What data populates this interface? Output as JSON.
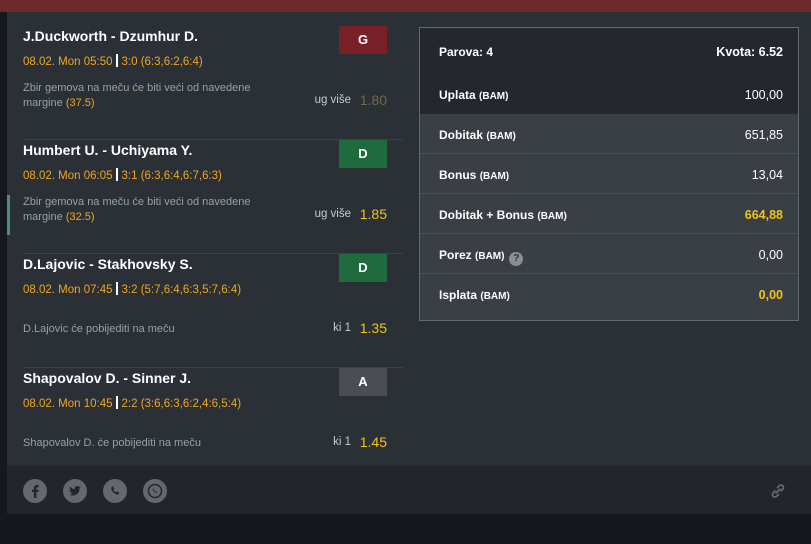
{
  "matches": [
    {
      "title": "J.Duckworth - Dzumhur D.",
      "datetime": "08.02. Mon 05:50",
      "result": "3:0 (6:3,6:2,6:4)",
      "desc": "Zbir gemova na meču će biti veći od navedene margine",
      "margin": "(37.5)",
      "type": "ug više",
      "odd": "1.80",
      "badge": "G"
    },
    {
      "title": "Humbert U. - Uchiyama Y.",
      "datetime": "08.02. Mon 06:05",
      "result": "3:1 (6:3,6:4,6:7,6:3)",
      "desc": "Zbir gemova na meču će biti veći od navedene margine",
      "margin": "(32.5)",
      "type": "ug više",
      "odd": "1.85",
      "badge": "D"
    },
    {
      "title": "D.Lajovic - Stakhovsky S.",
      "datetime": "08.02. Mon 07:45",
      "result": "3:2 (5:7,6:4,6:3,5:7,6:4)",
      "desc": "D.Lajovic će pobijediti na meču",
      "margin": "",
      "type": "ki 1",
      "odd": "1.35",
      "badge": "D"
    },
    {
      "title": "Shapovalov D. - Sinner J.",
      "datetime": "08.02. Mon 10:45",
      "result": "2:2 (3:6,6:3,6:2,4:6,5:4)",
      "desc": "Shapovalov D. će pobijediti na meču",
      "margin": "",
      "type": "ki 1",
      "odd": "1.45",
      "badge": "A"
    }
  ],
  "summary": {
    "parova": "Parova: 4",
    "kvota": "Kvota: 6.52",
    "unit": "(BAM)",
    "uplata_label": "Uplata",
    "uplata": "100,00",
    "dobitak_label": "Dobitak",
    "dobitak": "651,85",
    "bonus_label": "Bonus",
    "bonus": "13,04",
    "dobitak_bonus_label": "Dobitak + Bonus",
    "dobitak_bonus": "664,88",
    "porez_label": "Porez",
    "porez": "0,00",
    "isplata_label": "Isplata",
    "isplata": "0,00",
    "help_glyph": "?"
  },
  "icons": [
    "facebook-icon",
    "twitter-icon",
    "viber-icon",
    "whatsapp-icon",
    "link-icon"
  ],
  "colors": {
    "gold": "#f0c419",
    "orange": "#f0a81c",
    "badge_red": "#7a2027",
    "badge_green": "#1f6b3d",
    "badge_gray": "#4a4e54"
  }
}
